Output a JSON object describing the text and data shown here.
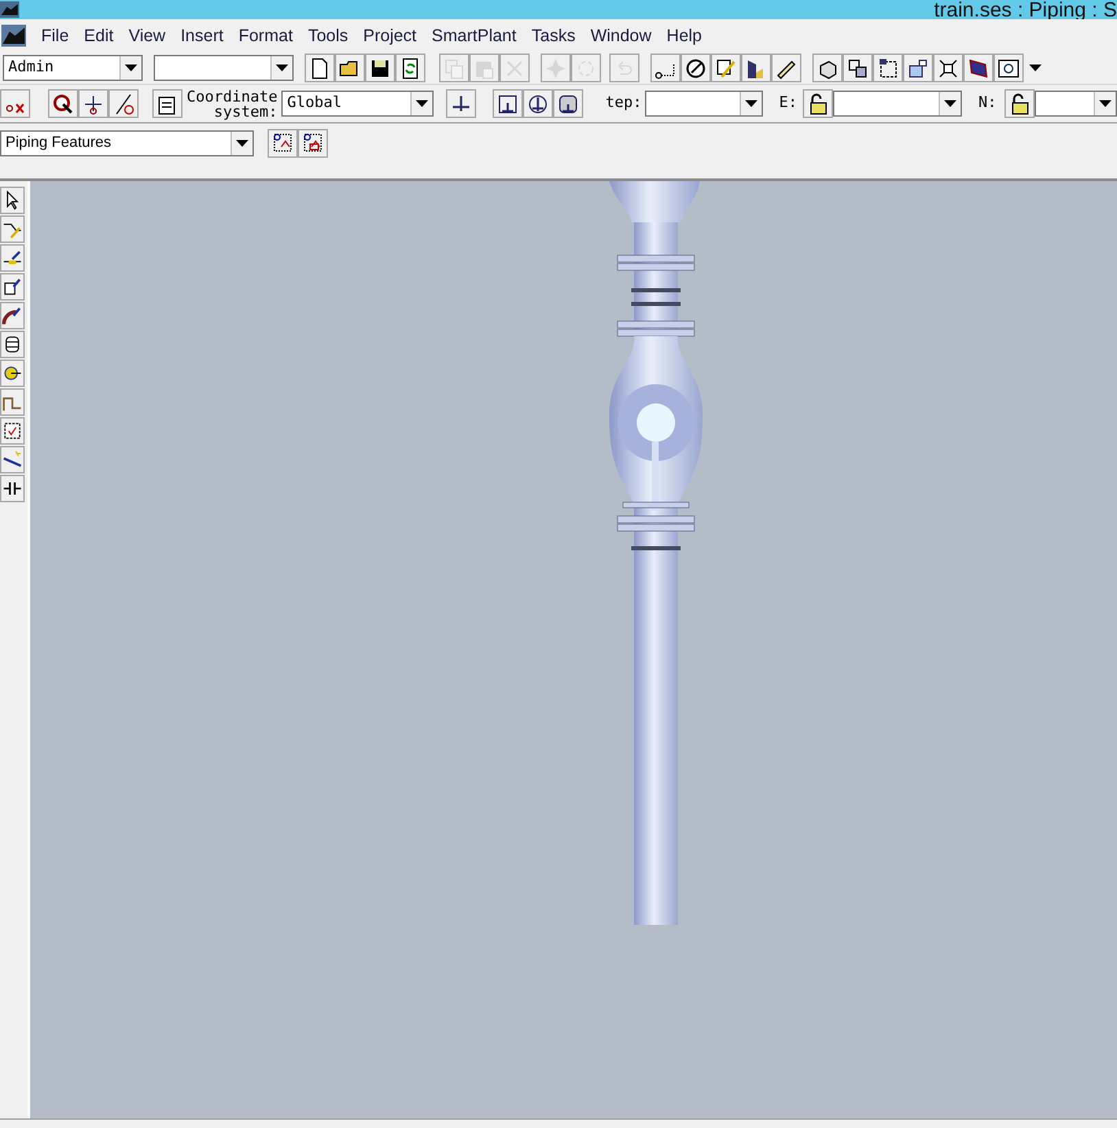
{
  "window": {
    "title": "train.ses : Piping : S"
  },
  "menu": [
    "File",
    "Edit",
    "View",
    "Insert",
    "Format",
    "Tools",
    "Project",
    "SmartPlant",
    "Tasks",
    "Window",
    "Help"
  ],
  "toolbar_1": {
    "combos": [
      {
        "value": "Admin"
      }
    ],
    "buttons": [
      {
        "disabled": false
      },
      {
        "disabled": false
      },
      {
        "disabled": false
      },
      {
        "disabled": false
      },
      {
        "disabled": true
      },
      {
        "disabled": true
      },
      {
        "disabled": true
      },
      {
        "disabled": true
      },
      {
        "disabled": true
      },
      {
        "disabled": true
      },
      {
        "disabled": false
      },
      {
        "disabled": false
      },
      {
        "disabled": false
      },
      {
        "disabled": false
      },
      {
        "disabled": false
      },
      {
        "disabled": false
      },
      {
        "disabled": false
      },
      {
        "disabled": false
      },
      {
        "disabled": false
      },
      {
        "disabled": false
      },
      {
        "disabled": false
      },
      {
        "disabled": false
      }
    ]
  },
  "toolbar_2": {
    "coordinate_label": "Coordinate\nsystem:",
    "coordinate_system": "Global",
    "step_label": "tep:",
    "e_label": "E:",
    "n_label": "N:"
  },
  "toolbar_3": {
    "task": "Piping Features"
  },
  "side_tools": [
    {
      "selected": false
    },
    {
      "selected": false
    },
    {
      "selected": false
    },
    {
      "selected": false
    },
    {
      "selected": false
    },
    {
      "selected": false
    },
    {
      "selected": false
    },
    {
      "selected": false
    },
    {
      "selected": false
    },
    {
      "selected": false
    },
    {
      "selected": false
    }
  ]
}
